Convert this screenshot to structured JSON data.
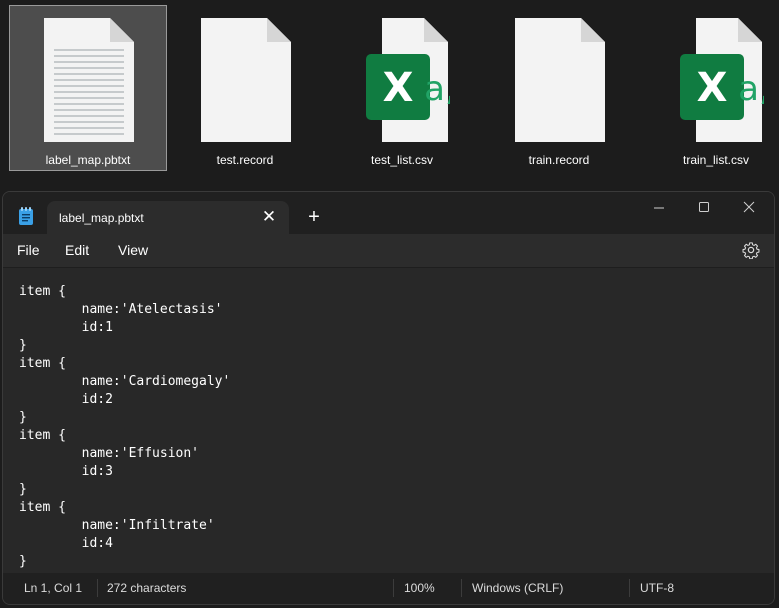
{
  "explorer": {
    "files": [
      {
        "name": "label_map.pbtxt",
        "type": "text"
      },
      {
        "name": "test.record",
        "type": "blank"
      },
      {
        "name": "test_list.csv",
        "type": "excel-csv"
      },
      {
        "name": "train.record",
        "type": "blank"
      },
      {
        "name": "train_list.csv",
        "type": "excel-csv"
      }
    ],
    "selected": "label_map.pbtxt",
    "excel_glyph": "X",
    "csv_glyph": "a,"
  },
  "notepad": {
    "tab_title": "label_map.pbtxt",
    "tab_close": "✕",
    "new_tab": "+",
    "window_controls": {
      "minimize": "—",
      "maximize": "☐",
      "close": "✕"
    },
    "menu": [
      "File",
      "Edit",
      "View"
    ],
    "content": "item {\n        name:'Atelectasis'\n        id:1\n}\nitem {\n        name:'Cardiomegaly'\n        id:2\n}\nitem {\n        name:'Effusion'\n        id:3\n}\nitem {\n        name:'Infiltrate'\n        id:4\n}",
    "status": {
      "position": "Ln 1, Col 1",
      "characters": "272 characters",
      "zoom": "100%",
      "line_ending": "Windows (CRLF)",
      "encoding": "UTF-8"
    }
  },
  "colors": {
    "excel_green": "#107c41",
    "csv_letter": "#21a366",
    "background": "#1c1c1c",
    "editor": "#282828"
  }
}
